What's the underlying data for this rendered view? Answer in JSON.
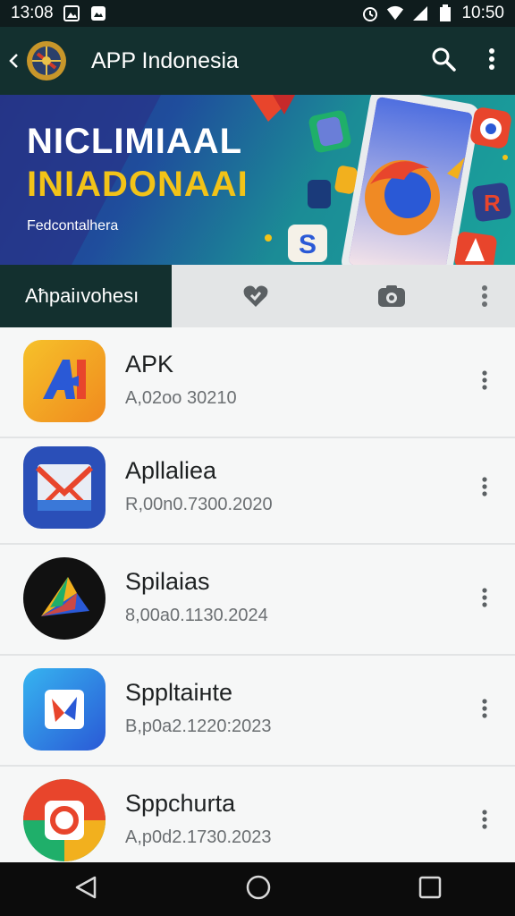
{
  "status_bar": {
    "time_left": "13:08",
    "time_right": "10:50"
  },
  "app_bar": {
    "title": "APP Indonesia"
  },
  "banner": {
    "line1": "NICLIMIAAL",
    "line2": "INIADONAAI",
    "line3": "Fedcontalhera"
  },
  "tabs": {
    "active_label": "Aħpaiıvohesı"
  },
  "apps": [
    {
      "name": "APK",
      "meta": "A,02oo 30210"
    },
    {
      "name": "Apllaliea",
      "meta": "R,00n0.7300.2020"
    },
    {
      "name": "Spilaias",
      "meta": "8,00a0.1130.2024"
    },
    {
      "name": "Sppltaiнte",
      "meta": "B,p0a2.1220:2023"
    },
    {
      "name": "Sppchurta",
      "meta": "A,p0d2.1730.2023"
    }
  ],
  "colors": {
    "appbar": "#13302f",
    "banner_yellow": "#f2c318",
    "status_bar": "#0f1c1d"
  },
  "icons": [
    "image-icon",
    "photo-icon",
    "alarm-icon",
    "wifi-icon",
    "signal-icon",
    "battery-icon",
    "search-icon",
    "more-vert-icon",
    "heart-icon",
    "camera-icon",
    "back-nav-icon",
    "home-nav-icon",
    "recents-nav-icon"
  ]
}
